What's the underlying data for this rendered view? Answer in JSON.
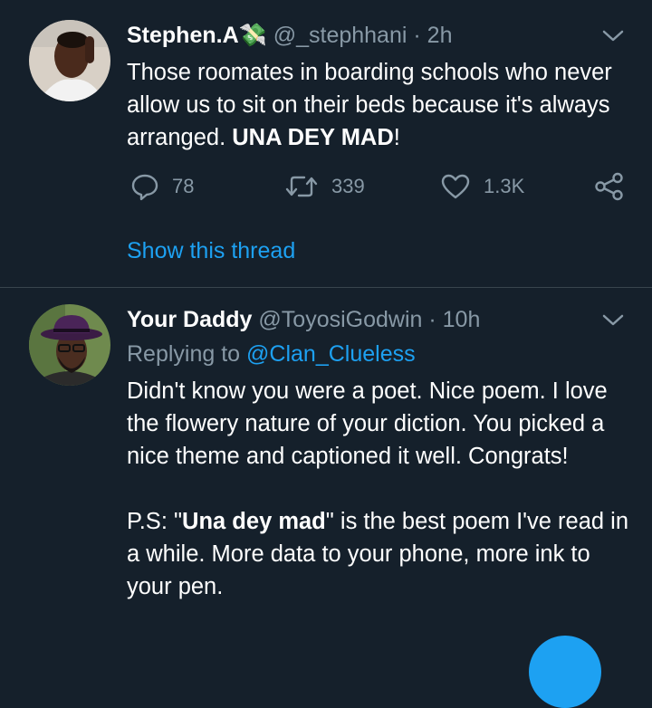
{
  "tweets": [
    {
      "name": "Stephen.A",
      "name_emoji": "💸",
      "handle": "@_stephhani",
      "separator": "·",
      "time": "2h",
      "text_normal": "Those roomates in boarding schools who never allow us to sit on their beds because it's always arranged. ",
      "text_bold": "UNA DEY MAD",
      "text_end": "!",
      "actions": {
        "replies": "78",
        "retweets": "339",
        "likes": "1.3K"
      },
      "show_thread": "Show this thread"
    },
    {
      "name": "Your Daddy",
      "handle": "@ToyosiGodwin",
      "separator": "·",
      "time": "10h",
      "replying_label": "Replying to",
      "replying_to": "@Clan_Clueless",
      "paragraph1": "Didn't know you were a poet. Nice poem. I love the flowery nature of your diction. You picked a nice theme and captioned it well. Congrats!",
      "p2_start": "P.S: \"",
      "p2_bold": "Una dey mad",
      "p2_end": "\" is the best poem I've read in a while. More data to your phone, more ink to your pen."
    }
  ],
  "icons": {
    "reply": "speech-bubble-icon",
    "retweet": "retweet-icon",
    "like": "heart-icon",
    "share": "share-icon",
    "menu": "chevron-down-icon"
  },
  "colors": {
    "background": "#15202b",
    "text": "#ffffff",
    "muted": "#8899a6",
    "accent": "#1da1f2",
    "divider": "#38444d"
  }
}
